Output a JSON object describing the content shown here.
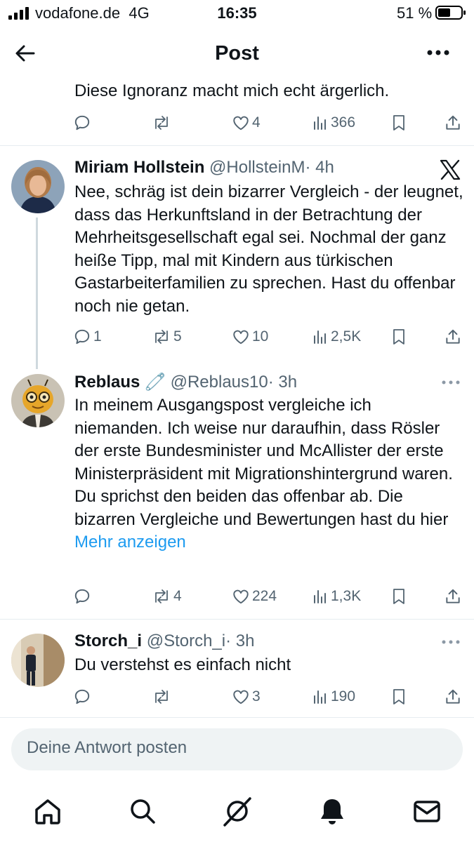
{
  "status_bar": {
    "carrier": "vodafone.de",
    "network": "4G",
    "time": "16:35",
    "battery": "51 %"
  },
  "header": {
    "title": "Post",
    "back_icon": "arrow-left-icon",
    "more_icon": "more-horizontal-icon"
  },
  "top_reply": {
    "text": "Diese Ignoranz macht mich echt ärgerlich.",
    "replies": "",
    "reposts": "",
    "likes": "4",
    "views": "366"
  },
  "main_tweet": {
    "name": "Miriam Hollstein",
    "handle": "@HollsteinM",
    "time": "· 4h",
    "platform_icon": "x-logo-icon",
    "text": "Nee, schräg ist dein bizarrer Vergleich - der leugnet, dass das Herkunftsland in der Betrachtung der Mehrheitsgesellschaft egal sei. Nochmal der ganz heiße Tipp, mal mit Kindern aus türkischen Gastarbeiterfamilien zu sprechen. Hast du offenbar noch nie getan.",
    "replies": "1",
    "reposts": "5",
    "likes": "10",
    "views": "2,5K"
  },
  "reply_1": {
    "name": "Reblaus",
    "name_emoji": "🧷",
    "handle": "@Reblaus10",
    "time": "· 3h",
    "text": "In meinem Ausgangspost vergleiche ich niemanden. Ich weise nur daraufhin, dass Rösler der erste Bundesminister und McAllister der erste Ministerpräsident mit Migrationshintergrund waren. Du sprichst den beiden das offenbar ab. Die bizarren Vergleiche und Bewertungen hast du hier",
    "more_link": "Mehr anzeigen",
    "replies": "",
    "reposts": "4",
    "likes": "224",
    "views": "1,3K"
  },
  "reply_2": {
    "name": "Storch_i",
    "handle": "@Storch_i",
    "time": "· 3h",
    "text": "Du verstehst es einfach nicht",
    "replies": "",
    "reposts": "",
    "likes": "3",
    "views": "190"
  },
  "reply_input": {
    "placeholder": "Deine Antwort posten"
  },
  "tab_bar": {
    "icons": [
      "home-icon",
      "search-icon",
      "grok-icon",
      "notifications-bell-icon",
      "messages-mail-icon"
    ]
  },
  "colors": {
    "link": "#1d9bf0",
    "secondary_text": "#536471",
    "divider": "#e6ecf0",
    "reply_box_bg": "#eff3f4"
  }
}
